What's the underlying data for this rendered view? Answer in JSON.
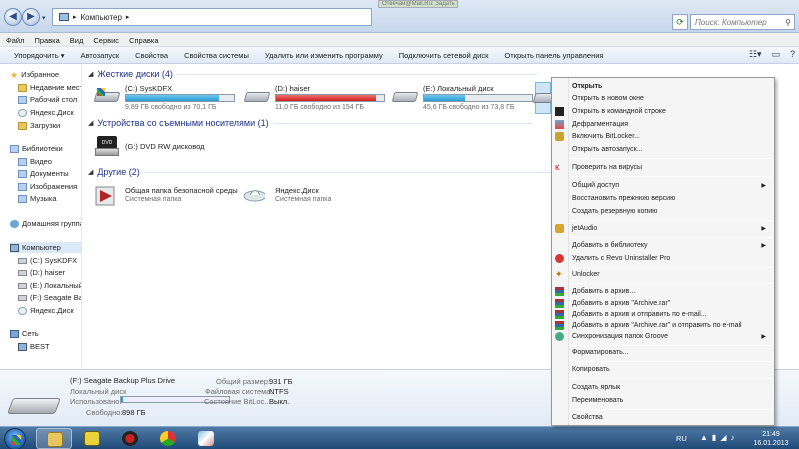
{
  "window": {
    "address": "Компьютер",
    "search_placeholder": "Поиск: Компьютер",
    "background_tab": "Отвечай@Mail.Ru: Задать в..."
  },
  "menubar": [
    "Файл",
    "Правка",
    "Вид",
    "Сервис",
    "Справка"
  ],
  "toolbar": {
    "organize": "Упорядочить ▾",
    "commands": [
      "Автозапуск",
      "Свойства",
      "Свойства системы",
      "Удалить или изменить программу",
      "Подключить сетевой диск",
      "Открыть панель управления"
    ]
  },
  "sidebar": {
    "favorites": "Избранное",
    "favorites_items": [
      "Недавние места",
      "Рабочий стол",
      "Яндекс.Диск",
      "Загрузки"
    ],
    "libraries": "Библиотеки",
    "library_items": [
      "Видео",
      "Документы",
      "Изображения",
      "Музыка"
    ],
    "homegroup": "Домашняя группа",
    "computer": "Компьютер",
    "computer_items": [
      "(C:) SysKDFX",
      "(D:) haiser",
      "(E:) Локальный диск",
      "(F:) Seagate Backup",
      "Яндекс.Диск"
    ],
    "network": "Сеть",
    "network_items": [
      "BEST"
    ]
  },
  "groups": {
    "hard_disks": "Жесткие диски (4)",
    "removable": "Устройства со съемными носителями (1)",
    "other": "Другие (2)"
  },
  "drives": [
    {
      "name": "(C:) SysKDFX",
      "free": "9,89 ГБ свободно из 70,1 ГБ",
      "used_fraction": 0.86,
      "color": "#2a9bd5"
    },
    {
      "name": "(D:) haiser",
      "free": "11,0 ГБ свободно из 154 ГБ",
      "used_fraction": 0.93,
      "color": "#d01e1e"
    },
    {
      "name": "(E:) Локальный диск",
      "free": "45,6 ГБ свободно из 73,8 ГБ",
      "used_fraction": 0.38,
      "color": "#2a9bd5"
    }
  ],
  "removable": [
    {
      "name": "(G:) DVD RW дисковод"
    }
  ],
  "others": [
    {
      "name": "Общая папка безопасной среды",
      "type": "Системная папка"
    },
    {
      "name": "Яндекс.Диск",
      "type": "Системная папка"
    }
  ],
  "details": {
    "title": "(F:) Seagate Backup Plus Drive",
    "subtitle": "Локальный диск",
    "used_label": "Использовано:",
    "used_fraction": 0.02,
    "free_label": "Свободно:",
    "free_value": "898 ГБ",
    "total_label": "Общий размер:",
    "total_value": "931 ГБ",
    "fs_label": "Файловая система:",
    "fs_value": "NTFS",
    "bitlocker_label": "Состояние BitLoc...",
    "bitlocker_value": "Выкл."
  },
  "context_menu": {
    "open": "Открыть",
    "open_new_window": "Открыть в новом окне",
    "open_cmd": "Открыть в командной строке",
    "defrag": "Дефрагментация",
    "bitlocker": "Включить BitLocker...",
    "autoplay": "Открыть автозапуск...",
    "scan": "Проверить на вирусы",
    "share": "Общий доступ",
    "restore": "Восстановить прежнюю версию",
    "backup": "Создать резервную копию",
    "jetaudio": "jetAudio",
    "add_library": "Добавить в библиотеку",
    "revo": "Удалить с Revo Uninstaller Pro",
    "unlocker": "Unlocker",
    "add_archive": "Добавить в архив...",
    "add_archive_rar": "Добавить в архив \"Archive.rar\"",
    "add_archive_email": "Добавить в архив и отправить по e-mail...",
    "add_archive_rar_email": "Добавить в архив \"Archive.rar\" и отправить по e-mail",
    "groove": "Синхронизация папок Groove",
    "format": "Форматировать...",
    "copy": "Копировать",
    "shortcut": "Создать ярлык",
    "rename": "Переименовать",
    "properties": "Свойства"
  },
  "taskbar": {
    "lang": "RU",
    "time": "21:49",
    "date": "16.01.2013"
  }
}
